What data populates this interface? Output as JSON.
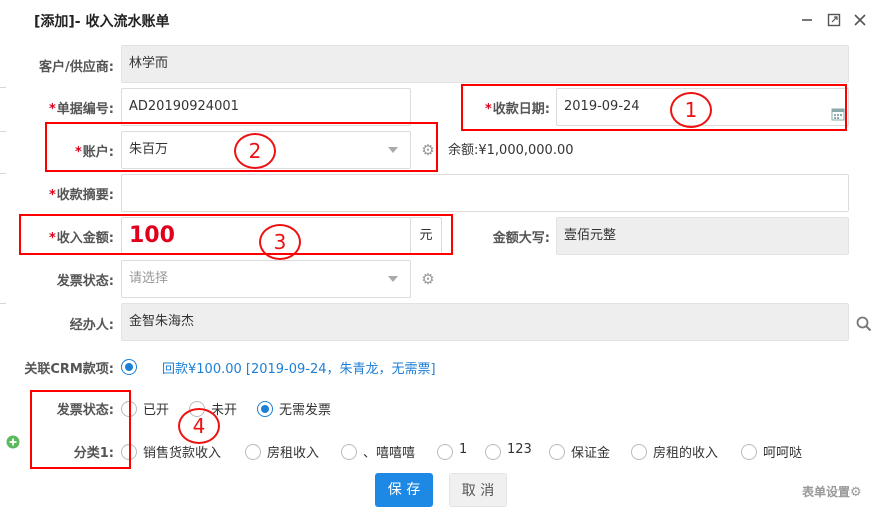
{
  "window": {
    "title": "[添加]- 收入流水账单",
    "icons": [
      "minimize-icon",
      "maximize-icon",
      "close-icon"
    ]
  },
  "form": {
    "customer": {
      "label": "客户/供应商:",
      "value": "林学而"
    },
    "doc_no": {
      "required": "*",
      "label": "单据编号:",
      "value": "AD20190924001"
    },
    "date": {
      "required": "*",
      "label": "收款日期:",
      "value": "2019-09-24"
    },
    "account": {
      "required": "*",
      "label": "账户:",
      "value": "朱百万",
      "balance": "余额:¥1,000,000.00"
    },
    "summary": {
      "required": "*",
      "label": "收款摘要:",
      "value": ""
    },
    "amount": {
      "required": "*",
      "label": "收入金额:",
      "value": "100",
      "unit": "元"
    },
    "amount_words": {
      "label": "金额大写:",
      "value": "壹佰元整"
    },
    "invoice_status_select": {
      "label": "发票状态:",
      "placeholder": "请选择"
    },
    "handler": {
      "label": "经办人:",
      "value": "金智朱海杰"
    },
    "crm": {
      "label": "关联CRM款项:",
      "value": "回款¥100.00 [2019-09-24，朱青龙，无需票]"
    },
    "invoice_status_radio": {
      "label": "发票状态:",
      "options": [
        "已开",
        "未开",
        "无需发票"
      ],
      "selected": "无需发票"
    },
    "category": {
      "label": "分类1:",
      "options": [
        "销售货款收入",
        "房租收入",
        "、嘻嘻嘻",
        "1",
        "123",
        "保证金",
        "房租的收入",
        "呵呵哒"
      ]
    }
  },
  "buttons": {
    "save": "保 存",
    "cancel": "取 消",
    "form_settings": "表单设置"
  },
  "annotations": [
    "1",
    "2",
    "3",
    "4"
  ],
  "colors": {
    "accent": "#1e88e5",
    "required": "#e0001b",
    "annotation": "#ff0000",
    "crm_link": "#1e7fd6"
  }
}
